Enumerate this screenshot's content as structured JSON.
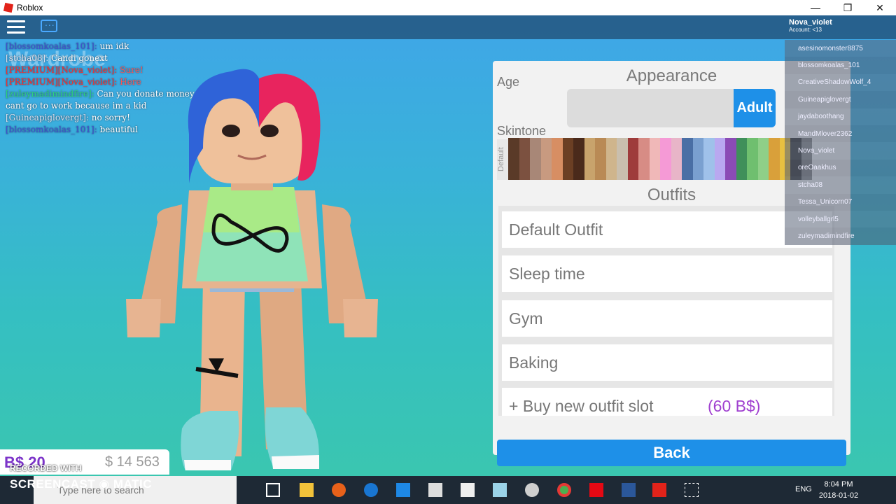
{
  "window": {
    "title": "Roblox",
    "minimize": "—",
    "maximize": "❐",
    "close": "✕"
  },
  "topbar": {
    "username": "Nova_violet",
    "account": "Account: <13"
  },
  "chat": [
    {
      "name": "[blossomkoalas_101]:",
      "msg": " um idk",
      "color": "n1"
    },
    {
      "name": "[stcha08]:",
      "msg": " Candi gonext",
      "color": "n4"
    },
    {
      "name": "[PREMIUM][Nova_violet]:",
      "msg": " Sure!",
      "color": "n2"
    },
    {
      "name": "[PREMIUM][Nova_violet]:",
      "msg": " Here",
      "color": "n2"
    },
    {
      "name": "[zuleymadimindfire]:",
      "msg": " Can you donate money to me plz a cant go to work because im a kid",
      "color": "n3"
    },
    {
      "name": "[Guineapiglovergt]:",
      "msg": " no sorry!",
      "color": "n4"
    },
    {
      "name": "[blossomkoalas_101]:",
      "msg": " beautiful",
      "color": "n1"
    }
  ],
  "wardrobe_title": "Wardrobe",
  "money": {
    "bt": "B$ 20",
    "cash": "$ 14 563"
  },
  "panel": {
    "title": "Appearance",
    "age_label": "Age",
    "age_button": "Adult",
    "skin_label": "Skintone",
    "skin_default": "Default",
    "swatches": [
      "#5a3a28",
      "#7c5140",
      "#a88777",
      "#c89a80",
      "#d78e63",
      "#6b3f24",
      "#4a2a1b",
      "#c8a36c",
      "#b98a55",
      "#cfb58c",
      "#c9bfae",
      "#9e3b3b",
      "#d78c85",
      "#f0b8b8",
      "#f59ad6",
      "#e8b5c8",
      "#4a6fa5",
      "#7aa0d0",
      "#9fc1ea",
      "#b9a8f0",
      "#8b4bb5",
      "#3f8f5a",
      "#6fbf6f",
      "#8fcf88",
      "#d9a03a",
      "#e8c040",
      "#3b3b3b",
      "#8a8a8a"
    ],
    "outfits_title": "Outfits",
    "outfits": [
      "Default Outfit",
      "Sleep time",
      "Gym",
      "Baking"
    ],
    "buy_slot": "+ Buy new outfit slot",
    "buy_price": "(60 B$)",
    "back": "Back"
  },
  "players": [
    "asesinomonster8875",
    "blossomkoalas_101",
    "CreativeShadowWolf_4",
    "Guineapiglovergt",
    "jaydaboothang",
    "MandMlover2362",
    "Nova_violet",
    "oreOaakhus",
    "stcha08",
    "Tessa_Unicorn07",
    "volleyballgrl5",
    "zuleymadimindfire"
  ],
  "taskbar": {
    "search_placeholder": "Type here to search",
    "lang": "ENG",
    "time": "8:04 PM",
    "date": "2018-01-02"
  },
  "watermark": {
    "recorded": "RECORDED WITH",
    "brand": "SCREENCAST ◉ MATIC"
  }
}
